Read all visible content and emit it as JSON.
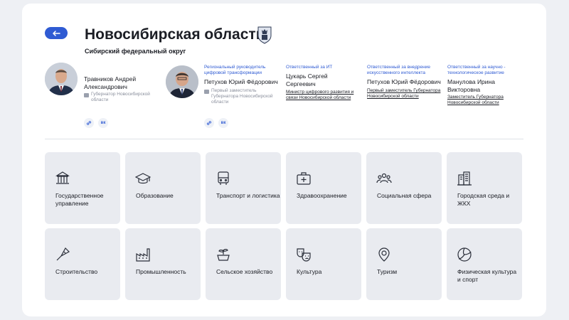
{
  "header": {
    "title": "Новосибирская область",
    "subtitle": "Сибирский федеральный округ"
  },
  "people": [
    {
      "caption": "",
      "name": "Травников Андрей Александрович",
      "role": "Губернатор Новосибирской области",
      "role_is_link": false
    },
    {
      "caption": "Региональный руководитель цифровой трансформации",
      "name": "Петухов Юрий Фёдорович",
      "role": "Первый заместитель Губернатора Новосибирской области",
      "role_is_link": false
    },
    {
      "caption": "Ответственный за ИТ",
      "name": "Цукарь Сергей Сергеевич",
      "role": "Министр цифрового развития и связи Новосибирской области",
      "role_is_link": true
    },
    {
      "caption": "Ответственный за внедрение искусственного интеллекта",
      "name": "Петухов Юрий Фёдорович",
      "role": "Первый заместитель Губернатора Новосибирской области",
      "role_is_link": true
    },
    {
      "caption": "Ответственный за научно - технологическое развитие",
      "name": "Манулова Ирина Викторовна",
      "role": "Заместитель Губернатора Новосибирской области",
      "role_is_link": true
    }
  ],
  "social": {
    "vk": "вк"
  },
  "tiles": [
    {
      "label": "Государственное управление",
      "icon": "government-building-icon"
    },
    {
      "label": "Образование",
      "icon": "graduation-cap-icon"
    },
    {
      "label": "Транспорт и логистика",
      "icon": "bus-icon"
    },
    {
      "label": "Здравоохранение",
      "icon": "medical-kit-icon"
    },
    {
      "label": "Социальная сфера",
      "icon": "people-group-icon"
    },
    {
      "label": "Городская среда и ЖКХ",
      "icon": "city-buildings-icon"
    },
    {
      "label": "Строительство",
      "icon": "trowel-icon"
    },
    {
      "label": "Промышленность",
      "icon": "factory-icon"
    },
    {
      "label": "Сельское хозяйство",
      "icon": "plant-icon"
    },
    {
      "label": "Культура",
      "icon": "theater-masks-icon"
    },
    {
      "label": "Туризм",
      "icon": "map-pin-icon"
    },
    {
      "label": "Физическая культура и спорт",
      "icon": "volleyball-icon"
    }
  ],
  "colors": {
    "accent": "#2f5bd3",
    "tile_bg": "#e9ebf0",
    "card_bg": "#ffffff",
    "page_bg": "#eef0f4"
  }
}
